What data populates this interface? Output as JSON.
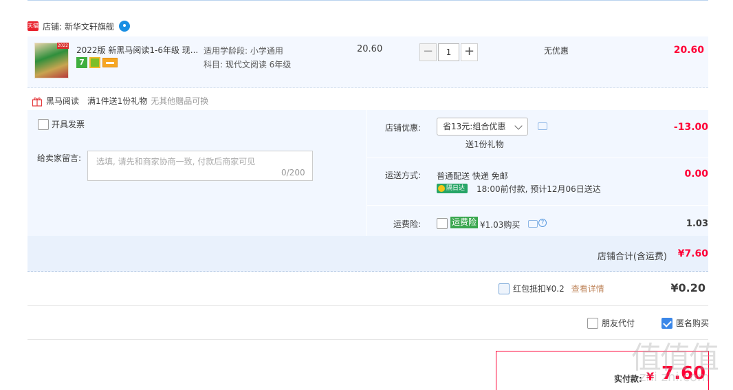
{
  "shop": {
    "badge": "天猫",
    "name": "店铺: 新华文轩旗舰"
  },
  "item": {
    "thumb_tag": "2022",
    "title": "2022版 新黑马阅读1-6年级 现...",
    "prop1": "适用学龄段: 小学通用",
    "prop2": "科目: 现代文阅读 6年级",
    "badge7": "7",
    "unit_price": "20.60",
    "qty_minus": "−",
    "qty": "1",
    "qty_plus": "+",
    "discount": "无优惠",
    "total": "20.60"
  },
  "gift": {
    "name": "黑马阅读",
    "desc": "满1件送1份礼物",
    "note": "无其他赠品可换"
  },
  "invoice": {
    "label": "开具发票"
  },
  "message": {
    "label": "给卖家留言:",
    "placeholder": "选填, 请先和商家协商一致, 付款后商家可见",
    "count": "0/200"
  },
  "shop_discount": {
    "label": "店铺优惠:",
    "selected": "省13元:组合优惠",
    "sub": "送1份礼物",
    "value": "-13.00"
  },
  "shipping": {
    "label": "运送方式:",
    "method": "普通配送 快递 免邮",
    "badge": "隔日达",
    "time": "18:00前付款, 预计12月06日送达",
    "value": "0.00"
  },
  "insurance": {
    "label": "运费险:",
    "tag": "运费险",
    "price": "¥1.03购买",
    "help": "?",
    "value": "1.03"
  },
  "shop_total": {
    "label": "店铺合计(含运费)",
    "value": "¥7.60"
  },
  "red_packet": {
    "text": "红包抵扣¥0.2",
    "link": "查看详情",
    "value": "¥0.20"
  },
  "options": {
    "friend_pay": "朋友代付",
    "anonymous": "匿名购买"
  },
  "payment": {
    "label": "实付款:",
    "currency": "¥",
    "value": "7.60"
  },
  "watermark": {
    "logo": "值值值",
    "url": "zhi zhi.com"
  },
  "colors": {
    "accent_red": "#ff0036",
    "panel_bg": "#f2f7ff",
    "tmall_red": "#e8222e",
    "check_blue": "#3b87e8"
  }
}
